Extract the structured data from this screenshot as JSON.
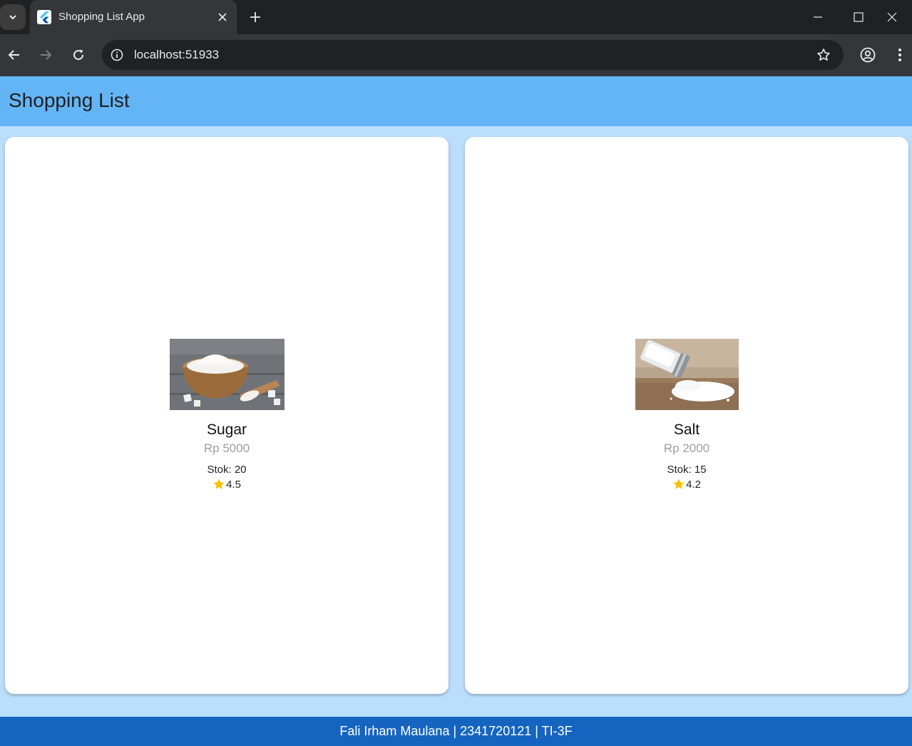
{
  "browser": {
    "tab_title": "Shopping List App",
    "url": "localhost:51933"
  },
  "app": {
    "title": "Shopping List",
    "footer": "Fali Irham Maulana | 2341720121 | TI-3F"
  },
  "items": [
    {
      "name": "Sugar",
      "price": "Rp 5000",
      "stock": "Stok: 20",
      "rating": "4.5",
      "image": "sugar-bowl"
    },
    {
      "name": "Salt",
      "price": "Rp 2000",
      "stock": "Stok: 15",
      "rating": "4.2",
      "image": "salt-shaker"
    }
  ],
  "colors": {
    "appbar": "#64b5f6",
    "background": "#bbdefb",
    "footer": "#1565c0",
    "star": "#ffc107"
  }
}
